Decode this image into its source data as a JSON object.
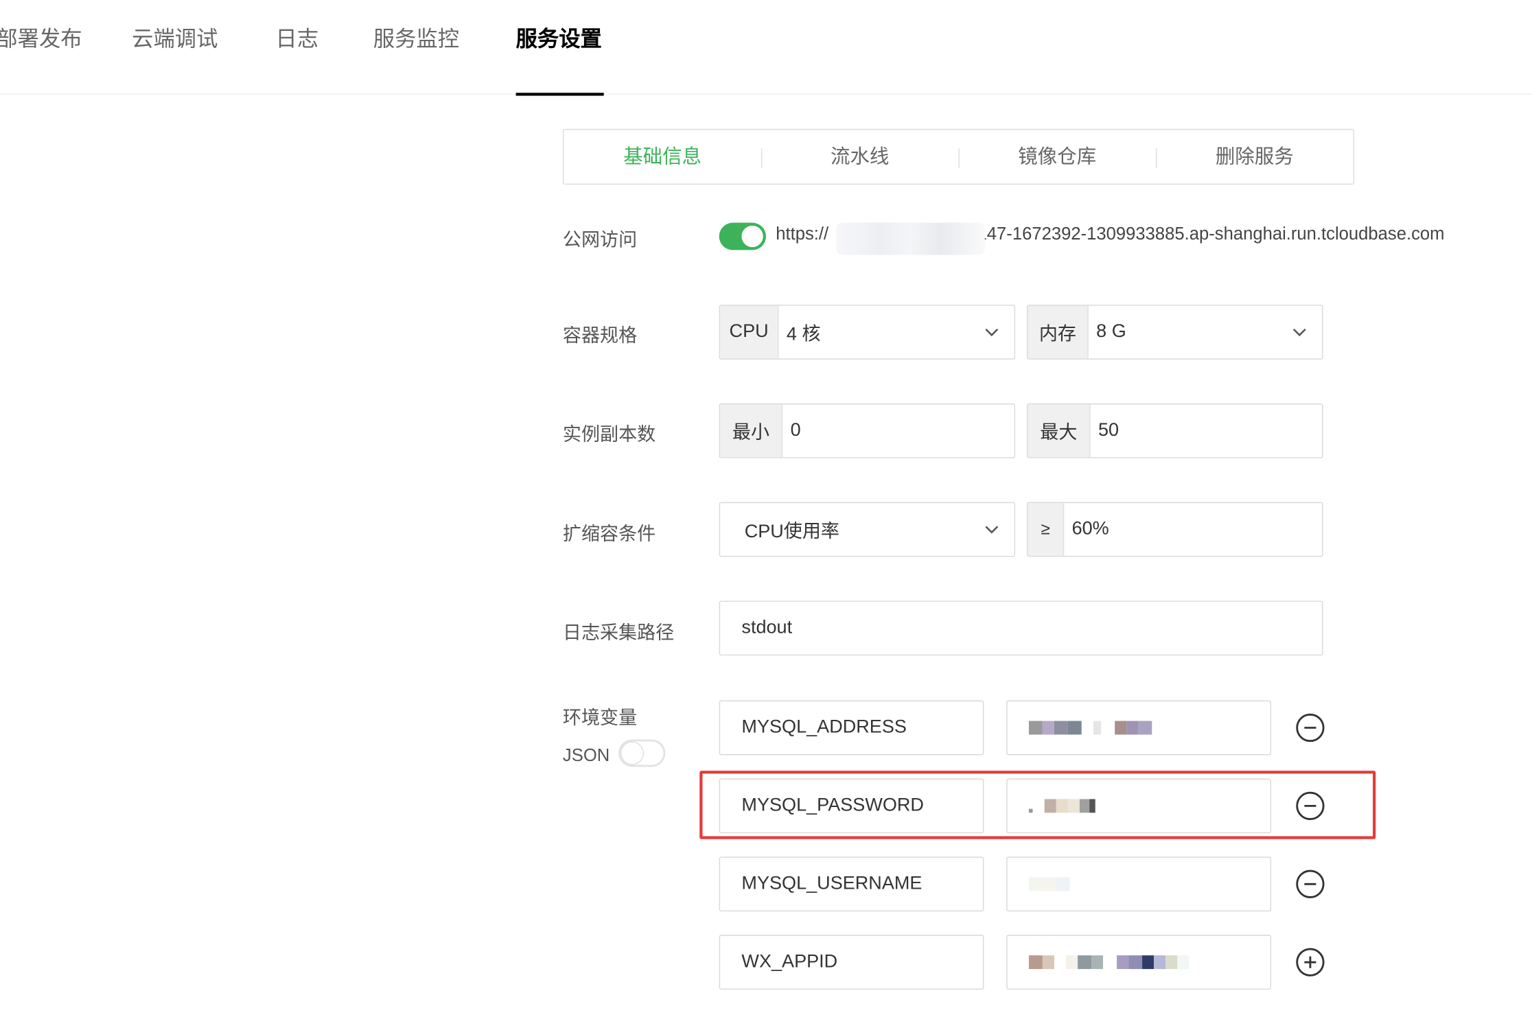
{
  "top_tabs": [
    {
      "label": "部署发布",
      "active": false
    },
    {
      "label": "云端调试",
      "active": false
    },
    {
      "label": "日志",
      "active": false
    },
    {
      "label": "服务监控",
      "active": false
    },
    {
      "label": "服务设置",
      "active": true
    }
  ],
  "sub_tabs": [
    {
      "label": "基础信息",
      "active": true
    },
    {
      "label": "流水线",
      "active": false
    },
    {
      "label": "镜像仓库",
      "active": false
    },
    {
      "label": "删除服务",
      "active": false
    }
  ],
  "public_access": {
    "label": "公网访问",
    "enabled": true,
    "url_prefix": "https://",
    "url_suffix": "147-1672392-1309933885.ap-shanghai.run.tcloudbase.com"
  },
  "container_spec": {
    "label": "容器规格",
    "cpu_label": "CPU",
    "cpu_value": "4 核",
    "mem_label": "内存",
    "mem_value": "8 G"
  },
  "replicas": {
    "label": "实例副本数",
    "min_label": "最小",
    "min_value": "0",
    "max_label": "最大",
    "max_value": "50"
  },
  "scaling": {
    "label": "扩缩容条件",
    "metric": "CPU使用率",
    "operator": "≥",
    "threshold": "60%"
  },
  "log_path": {
    "label": "日志采集路径",
    "value": "stdout"
  },
  "env": {
    "label": "环境变量",
    "json_label": "JSON",
    "json_enabled": false,
    "vars": [
      {
        "key": "MYSQL_ADDRESS",
        "action": "remove",
        "highlighted": false
      },
      {
        "key": "MYSQL_PASSWORD",
        "action": "remove",
        "highlighted": true
      },
      {
        "key": "MYSQL_USERNAME",
        "action": "remove",
        "highlighted": false
      },
      {
        "key": "WX_APPID",
        "action": "add",
        "highlighted": false
      }
    ]
  },
  "colors": {
    "accent_green": "#3cb35a",
    "highlight_red": "#e63b3b",
    "addon_bg": "#f0f0f0",
    "border": "#d9d9d9"
  }
}
